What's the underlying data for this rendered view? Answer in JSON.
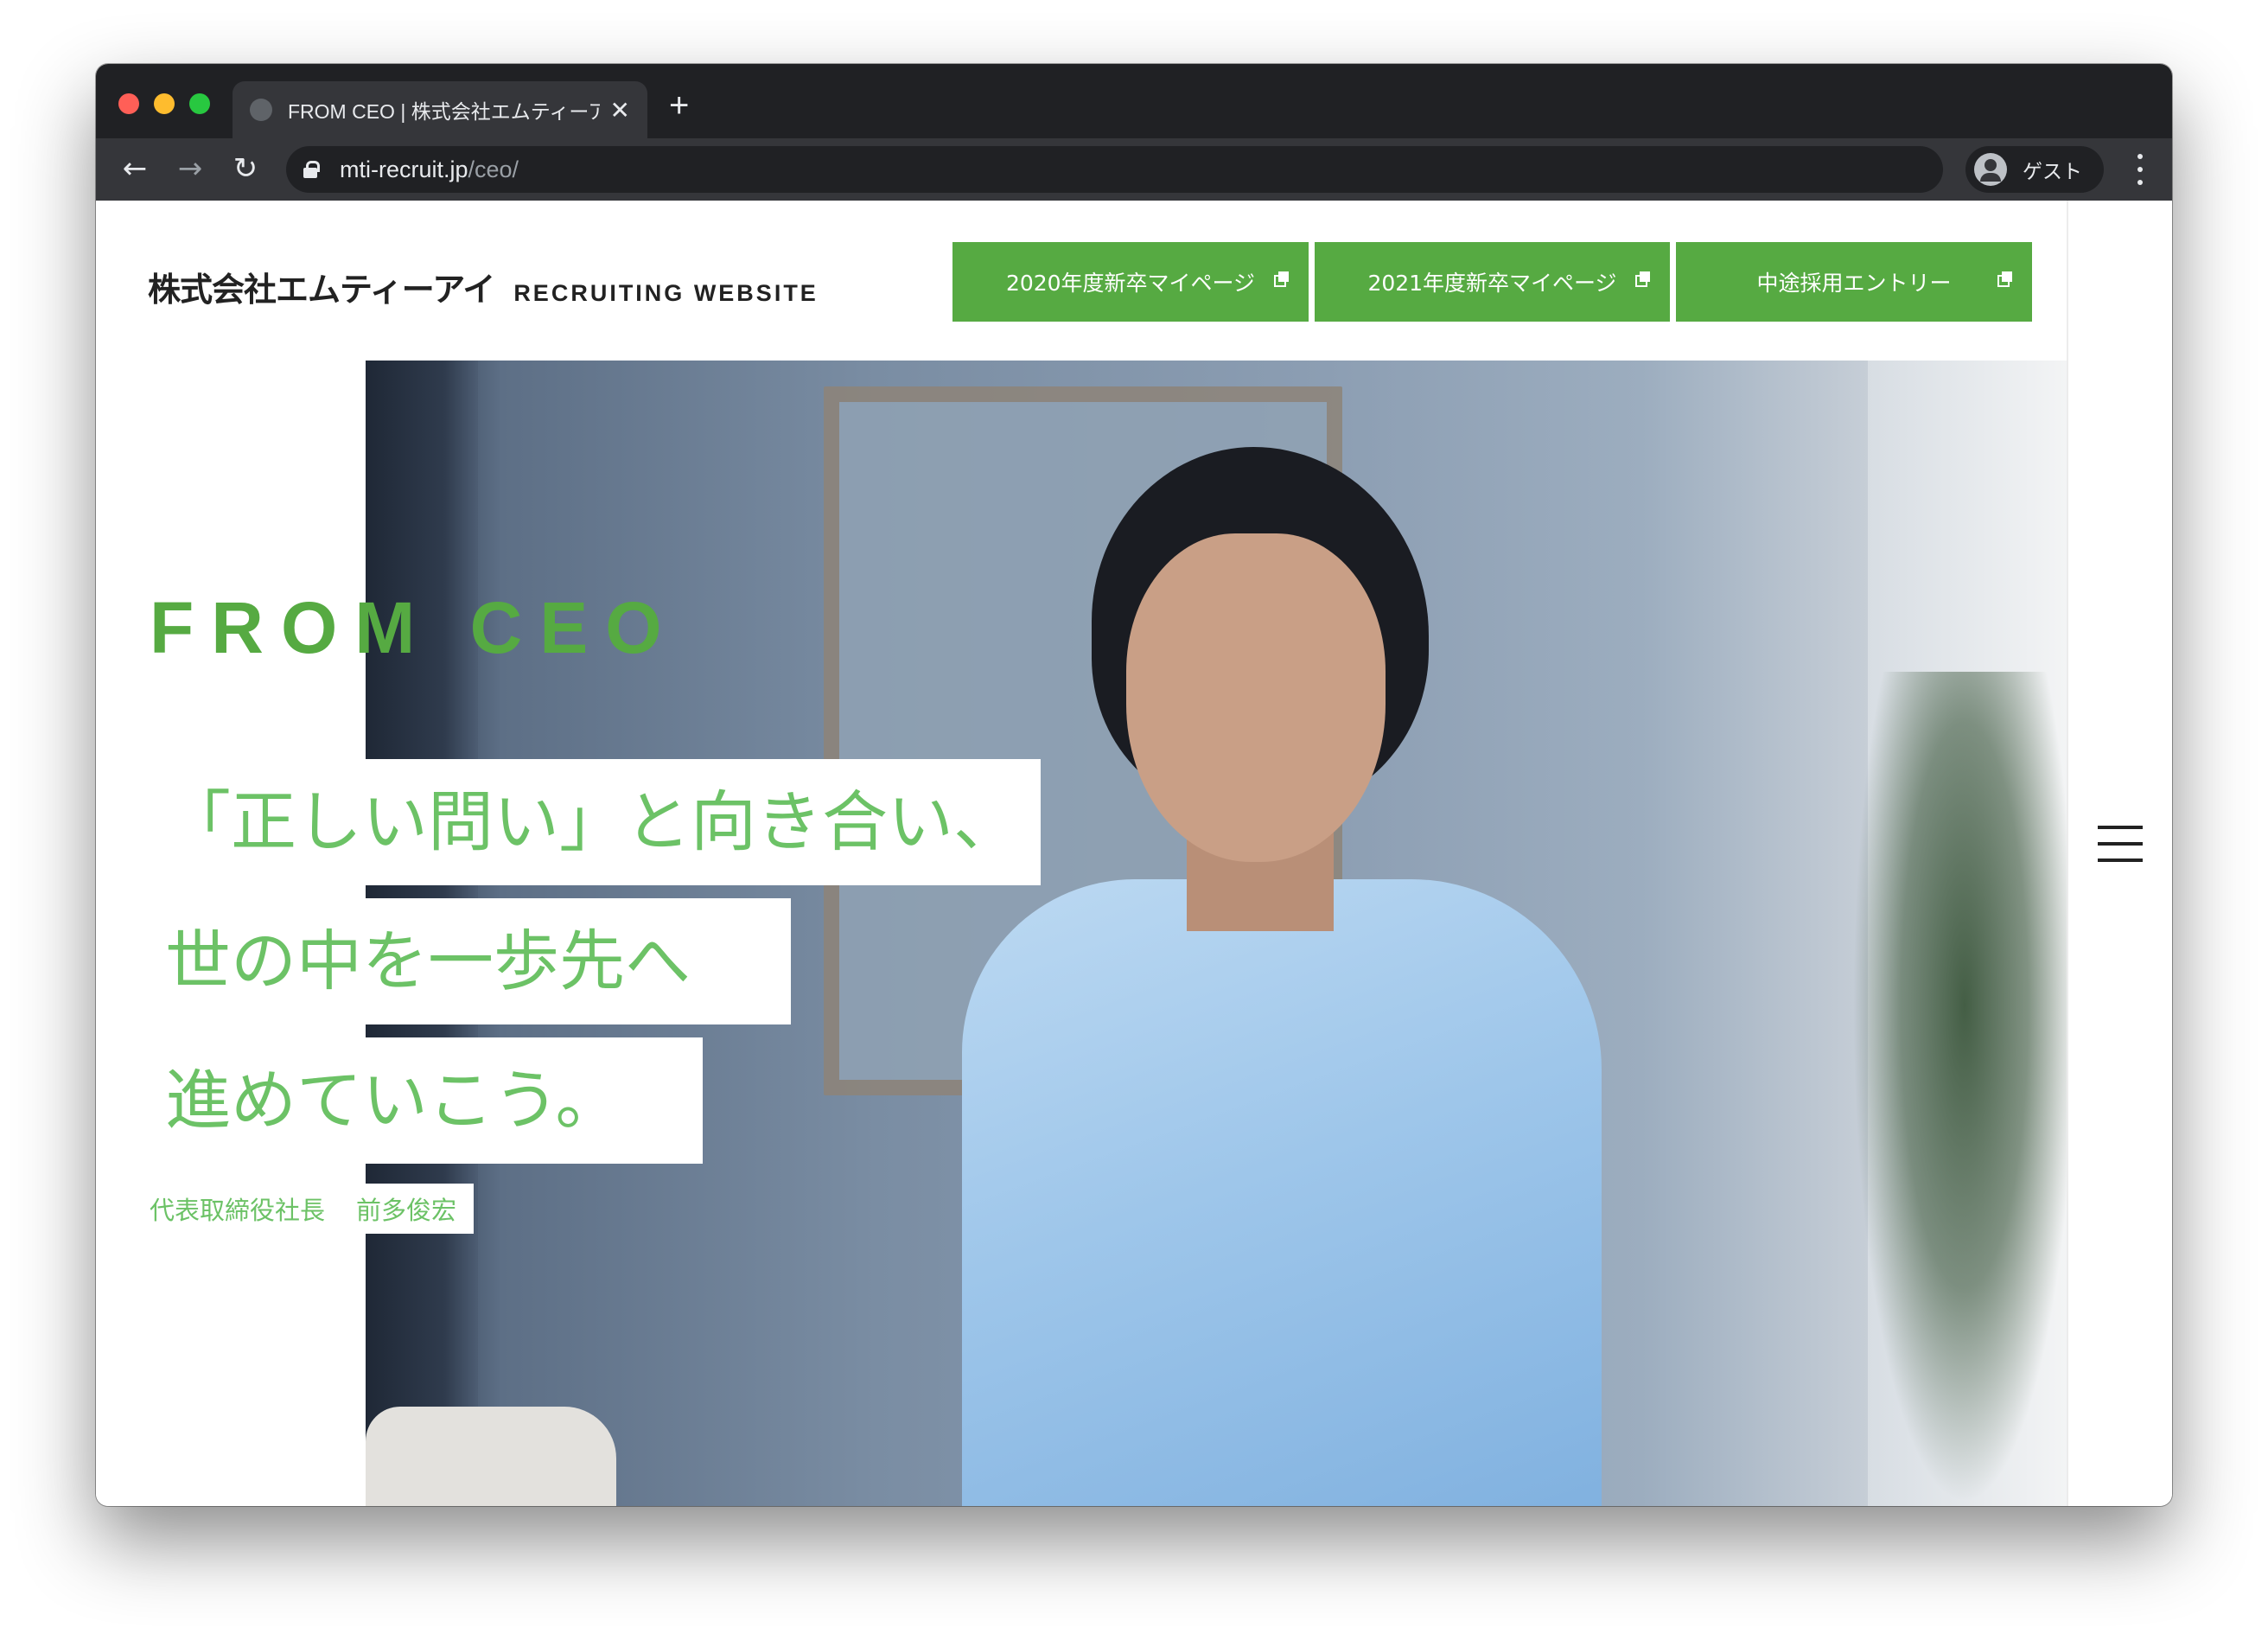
{
  "browser": {
    "tab_title": "FROM CEO | 株式会社エムティーア",
    "tab_close": "✕",
    "new_tab": "+",
    "url_host": "mti-recruit.jp",
    "url_path": "/ceo/",
    "profile_label": "ゲスト",
    "back_glyph": "←",
    "forward_glyph": "→",
    "reload_glyph": "↻"
  },
  "header": {
    "logo_jp": "株式会社エムティーアイ",
    "logo_en": "RECRUITING WEBSITE",
    "buttons": [
      {
        "label": "2020年度新卒マイページ"
      },
      {
        "label": "2021年度新卒マイページ"
      },
      {
        "label": "中途採用エントリー"
      }
    ],
    "accent_color": "#56aa42"
  },
  "hero": {
    "section_label": "FROM CEO",
    "catch_lines": [
      "「正しい問い」と向き合い、",
      "世の中を一歩先へ",
      "進めていこう。"
    ],
    "role": "代表取締役社長",
    "name": "前多俊宏",
    "text_color": "#6cc266"
  },
  "menu_icon": "hamburger-icon"
}
